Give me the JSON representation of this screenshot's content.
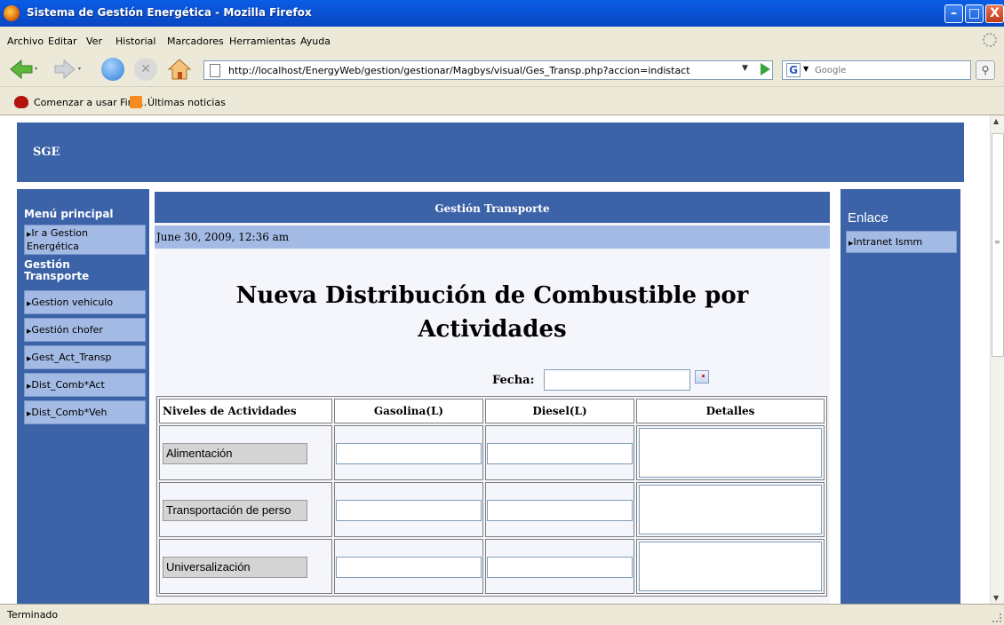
{
  "window": {
    "title": "Sistema de Gestión Energética - Mozilla Firefox",
    "buttons": {
      "minimize": "–",
      "maximize": "□",
      "close": "X"
    }
  },
  "menu": [
    "Archivo",
    "Editar",
    "Ver",
    "Historial",
    "Marcadores",
    "Herramientas",
    "Ayuda"
  ],
  "nav": {
    "url": "http://localhost/EnergyWeb/gestion/gestionar/Magbys/visual/Ges_Transp.php?accion=indistact",
    "search_placeholder": "Google",
    "search_engine_glyph": "G"
  },
  "bookmarks": [
    "Comenzar a usar Fire...",
    "Últimas noticias"
  ],
  "page": {
    "brand": "SGE",
    "left_menu": {
      "section1": "Menú principal",
      "link1_line1": "Ir a Gestion",
      "link1_line2": "Energética",
      "section2_line1": "Gestión",
      "section2_line2": "Transporte",
      "links": [
        "Gestion vehiculo",
        "Gestión chofer",
        "Gest_Act_Transp",
        "Dist_Comb*Act",
        "Dist_Comb*Veh"
      ]
    },
    "main": {
      "bar_title": "Gestión Transporte",
      "date": "June 30, 2009, 12:36 am",
      "heading_line1": "Nueva Distribución de Combustible por",
      "heading_line2": "Actividades",
      "fecha_label": "Fecha:",
      "columns": [
        "Niveles de Actividades",
        "Gasolina(L)",
        "Diesel(L)",
        "Detalles"
      ],
      "rows": [
        {
          "activity": "Alimentación"
        },
        {
          "activity": "Transportación de perso"
        },
        {
          "activity": "Universalización"
        }
      ]
    },
    "right_menu": {
      "section": "Enlace",
      "link": "Intranet Ismm"
    }
  },
  "status": "Terminado",
  "colors": {
    "panel_blue": "#3c62a8",
    "link_blue": "#a3bae4",
    "titlebar": "#0a5ce6"
  }
}
